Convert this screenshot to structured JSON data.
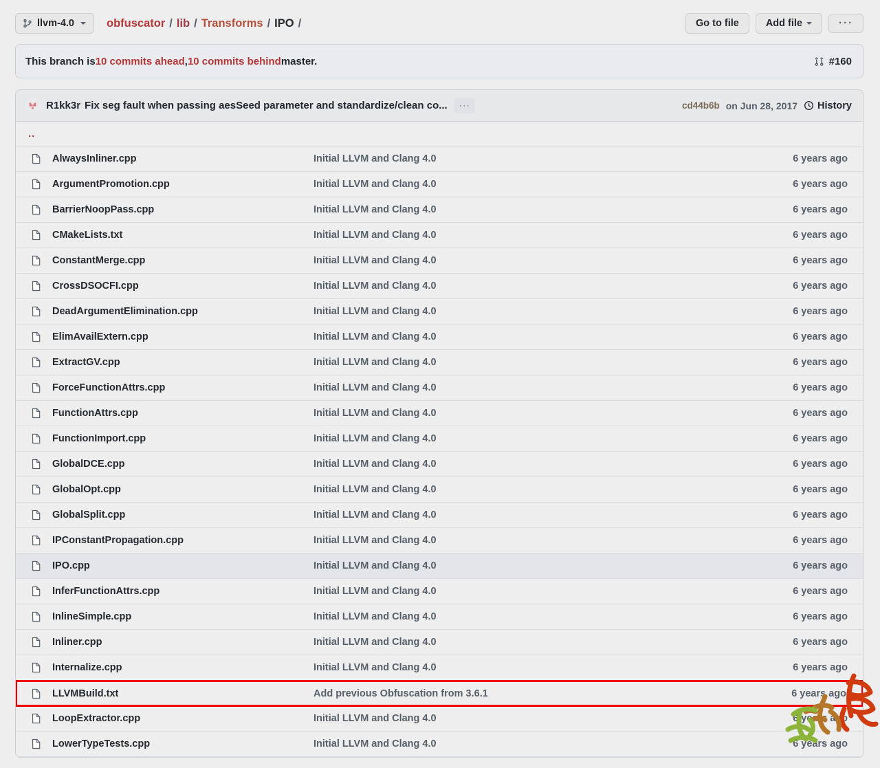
{
  "toolbar": {
    "branch": {
      "label": "llvm-4.0",
      "icon": "branch-icon"
    },
    "breadcrumb": [
      {
        "label": "obfuscator",
        "sep": "/"
      },
      {
        "label": "lib",
        "sep": "/"
      },
      {
        "label": "Transforms",
        "sep": "/"
      },
      {
        "label": "IPO",
        "sep": "/"
      }
    ],
    "go_to_file_label": "Go to file",
    "add_file_label": "Add file",
    "more_label": "···"
  },
  "banner": {
    "prefix": "This branch is ",
    "ahead": "10 commits ahead",
    "middle": ", ",
    "behind": "10 commits behind",
    "suffix": " master.",
    "pr_number": "#160",
    "pr_icon": "pull-request-icon"
  },
  "commit": {
    "author": "R1kk3r",
    "message": "Fix seg fault when passing aesSeed parameter and standardize/clean co...",
    "expand_label": "···",
    "sha": "cd44b6b",
    "date": "on Jun 28, 2017",
    "history_label": "History",
    "history_icon": "history-clock-icon"
  },
  "parent_dir": {
    "label": ".."
  },
  "files": [
    {
      "name": "AlwaysInliner.cpp",
      "message": "Initial LLVM and Clang 4.0",
      "time": "6 years ago",
      "state": "normal"
    },
    {
      "name": "ArgumentPromotion.cpp",
      "message": "Initial LLVM and Clang 4.0",
      "time": "6 years ago",
      "state": "normal"
    },
    {
      "name": "BarrierNoopPass.cpp",
      "message": "Initial LLVM and Clang 4.0",
      "time": "6 years ago",
      "state": "normal"
    },
    {
      "name": "CMakeLists.txt",
      "message": "Initial LLVM and Clang 4.0",
      "time": "6 years ago",
      "state": "normal"
    },
    {
      "name": "ConstantMerge.cpp",
      "message": "Initial LLVM and Clang 4.0",
      "time": "6 years ago",
      "state": "normal"
    },
    {
      "name": "CrossDSOCFI.cpp",
      "message": "Initial LLVM and Clang 4.0",
      "time": "6 years ago",
      "state": "normal"
    },
    {
      "name": "DeadArgumentElimination.cpp",
      "message": "Initial LLVM and Clang 4.0",
      "time": "6 years ago",
      "state": "normal"
    },
    {
      "name": "ElimAvailExtern.cpp",
      "message": "Initial LLVM and Clang 4.0",
      "time": "6 years ago",
      "state": "normal"
    },
    {
      "name": "ExtractGV.cpp",
      "message": "Initial LLVM and Clang 4.0",
      "time": "6 years ago",
      "state": "normal"
    },
    {
      "name": "ForceFunctionAttrs.cpp",
      "message": "Initial LLVM and Clang 4.0",
      "time": "6 years ago",
      "state": "normal"
    },
    {
      "name": "FunctionAttrs.cpp",
      "message": "Initial LLVM and Clang 4.0",
      "time": "6 years ago",
      "state": "normal"
    },
    {
      "name": "FunctionImport.cpp",
      "message": "Initial LLVM and Clang 4.0",
      "time": "6 years ago",
      "state": "normal"
    },
    {
      "name": "GlobalDCE.cpp",
      "message": "Initial LLVM and Clang 4.0",
      "time": "6 years ago",
      "state": "normal"
    },
    {
      "name": "GlobalOpt.cpp",
      "message": "Initial LLVM and Clang 4.0",
      "time": "6 years ago",
      "state": "normal"
    },
    {
      "name": "GlobalSplit.cpp",
      "message": "Initial LLVM and Clang 4.0",
      "time": "6 years ago",
      "state": "normal"
    },
    {
      "name": "IPConstantPropagation.cpp",
      "message": "Initial LLVM and Clang 4.0",
      "time": "6 years ago",
      "state": "normal"
    },
    {
      "name": "IPO.cpp",
      "message": "Initial LLVM and Clang 4.0",
      "time": "6 years ago",
      "state": "highlighted"
    },
    {
      "name": "InferFunctionAttrs.cpp",
      "message": "Initial LLVM and Clang 4.0",
      "time": "6 years ago",
      "state": "normal"
    },
    {
      "name": "InlineSimple.cpp",
      "message": "Initial LLVM and Clang 4.0",
      "time": "6 years ago",
      "state": "normal"
    },
    {
      "name": "Inliner.cpp",
      "message": "Initial LLVM and Clang 4.0",
      "time": "6 years ago",
      "state": "normal"
    },
    {
      "name": "Internalize.cpp",
      "message": "Initial LLVM and Clang 4.0",
      "time": "6 years ago",
      "state": "normal"
    },
    {
      "name": "LLVMBuild.txt",
      "message": "Add previous Obfuscation from 3.6.1",
      "time": "6 years ago",
      "state": "marked"
    },
    {
      "name": "LoopExtractor.cpp",
      "message": "Initial LLVM and Clang 4.0",
      "time": "6 years ago",
      "state": "normal"
    },
    {
      "name": "LowerTypeTests.cpp",
      "message": "Initial LLVM and Clang 4.0",
      "time": "6 years ago",
      "state": "normal"
    }
  ],
  "colors": {
    "page_bg": "#eeeeee",
    "link_red": "#b4373a",
    "text": "#24292f",
    "muted": "#57606a",
    "marker_red": "#f00000",
    "row_alt": "#e3e5e8"
  }
}
